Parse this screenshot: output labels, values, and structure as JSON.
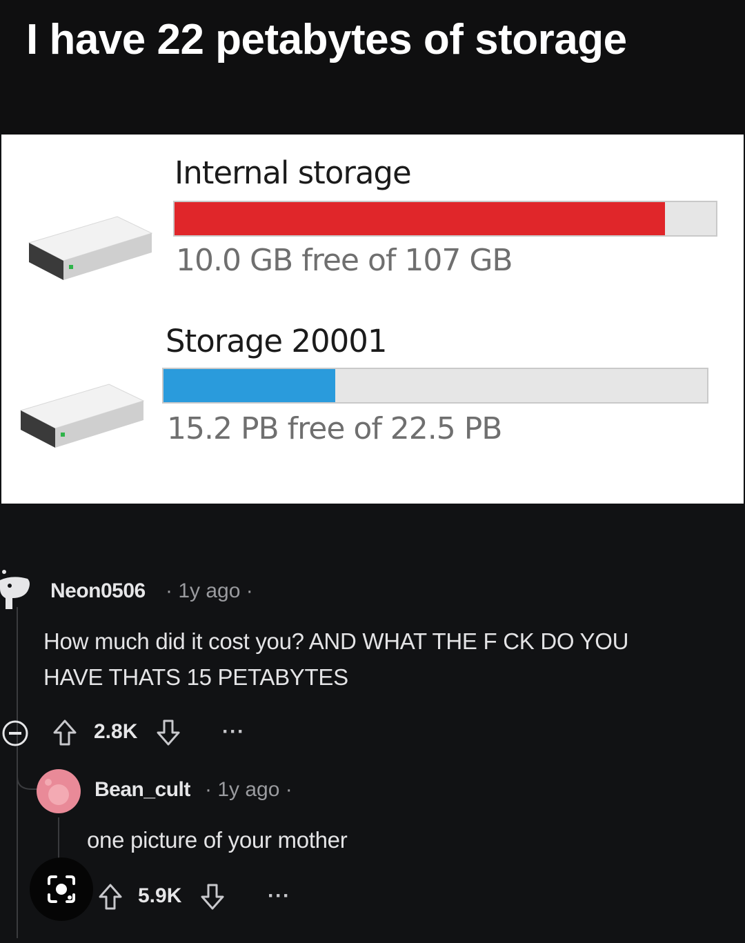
{
  "post": {
    "title": "I have 22 petabytes of storage"
  },
  "drives": [
    {
      "name": "Internal storage",
      "free_text": "10.0 GB free of 107 GB",
      "used_fraction": 0.906,
      "bar_color": "#e0262a"
    },
    {
      "name": "Storage 20001",
      "free_text": "15.2 PB free of 22.5 PB",
      "used_fraction": 0.316,
      "bar_color": "#2a9bdc"
    }
  ],
  "comments": [
    {
      "username": "Neon0506",
      "meta": "· 1y ago ·",
      "body_line_1": "How much did it cost you? AND WHAT THE F   CK DO YOU",
      "body_line_2": "HAVE THATS 15 PETABYTES",
      "votes": "2.8K",
      "more": "···"
    },
    {
      "username": "Bean_cult",
      "meta": "· 1y ago ·",
      "body": "one picture of your mother",
      "votes": "5.9K",
      "more": "···"
    }
  ],
  "colors": {
    "background": "#111214",
    "storage_panel": "#ffffff",
    "avatar_pink": "#e98a98"
  }
}
